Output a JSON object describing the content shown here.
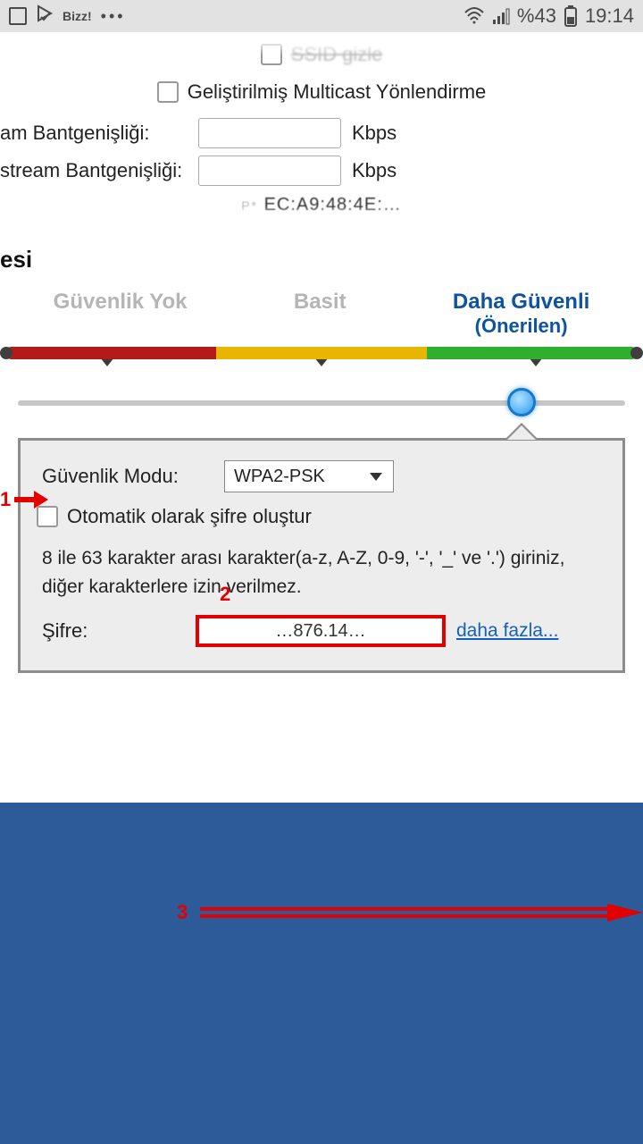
{
  "statusbar": {
    "bizz": "Bizz!",
    "battery_pct": "%43",
    "time": "19:14"
  },
  "top": {
    "truncated_line": "",
    "multicast_label": "Geliştirilmiş Multicast Yönlendirme",
    "row1_label": "am Bantgenişliği:",
    "row1_unit": "Kbps",
    "row2_label": "stream Bantgenişliği:",
    "row2_unit": "Kbps",
    "mac": "EC:A9:48:4E:…"
  },
  "section_title": "esi",
  "tabs": {
    "t1": "Güvenlik Yok",
    "t2": "Basit",
    "t3a": "Daha Güvenli",
    "t3b": "(Önerilen)"
  },
  "panel": {
    "mode_label": "Güvenlik Modu:",
    "mode_value": "WPA2-PSK",
    "autogen_label": "Otomatik olarak şifre oluştur",
    "hint": "8 ile 63 karakter arası karakter(a-z, A-Z, 0-9, '-', '_' ve '.') giriniz, diğer karakterlere izin verilmez.",
    "pwd_label": "Şifre:",
    "pwd_value": "…876.14…",
    "more": "daha fazla..."
  },
  "annotations": {
    "n1": "1",
    "n2": "2",
    "n3": "3"
  }
}
